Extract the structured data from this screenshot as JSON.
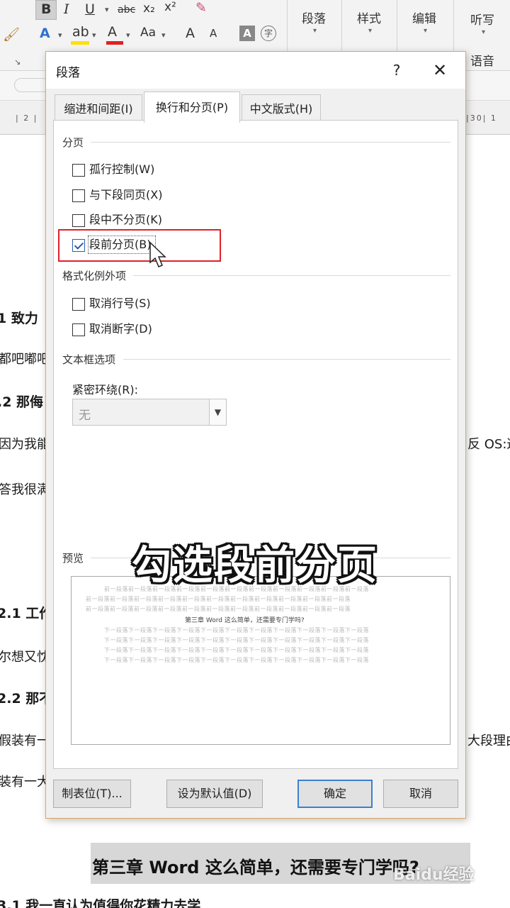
{
  "ribbon": {
    "format_glyphs": [
      "B",
      "I",
      "U",
      "abc",
      "x₂",
      "x²",
      "A",
      "A",
      "Aa",
      "A",
      "A"
    ],
    "groups": [
      "段落",
      "样式",
      "编辑",
      "听写",
      "语音"
    ]
  },
  "ruler": {
    "left_mark": "| 2 |",
    "right_mark": "|30|  1"
  },
  "document": {
    "fragments": [
      "1 致力",
      "都吧嘟吧",
      ".2 那侮",
      "因为我能",
      "答我很满",
      "2.1 工作",
      "尔想又忱",
      "2.2 那不",
      "假装有一",
      "装有一大",
      "反 OS:这",
      "大段理由"
    ],
    "chapter_title": "第三章 Word 这么简单，还需要专门学吗?",
    "bottom_fragment": "3.1 我一直认为值得你花精力去学",
    "watermark": "Baidu经验"
  },
  "dialog": {
    "title": "段落",
    "help": "?",
    "close": "✕",
    "tabs": [
      {
        "label": "缩进和间距(I)"
      },
      {
        "label": "换行和分页(P)"
      },
      {
        "label": "中文版式(H)"
      }
    ],
    "sections": {
      "pagination": "分页",
      "format_exceptions": "格式化例外项",
      "textbox_options": "文本框选项",
      "preview": "预览"
    },
    "checkboxes": [
      {
        "label": "孤行控制(W)",
        "checked": false
      },
      {
        "label": "与下段同页(X)",
        "checked": false
      },
      {
        "label": "段中不分页(K)",
        "checked": false
      },
      {
        "label": "段前分页(B)",
        "checked": true
      },
      {
        "label": "取消行号(S)",
        "checked": false
      },
      {
        "label": "取消断字(D)",
        "checked": false
      }
    ],
    "tight_wrap": {
      "label": "紧密环绕(R):",
      "value": "无"
    },
    "preview": {
      "before_line": "前一段落前一段落前一段落前一段落前一段落前一段落前一段落前一段落前一段落前一段落前一段落",
      "sample_title": "第三章 Word 这么简单，还需要专门学吗?",
      "after_line": "下一段落下一段落下一段落下一段落下一段落下一段落下一段落下一段落下一段落下一段落下一段落"
    },
    "buttons": {
      "tabs": "制表位(T)...",
      "set_default": "设为默认值(D)",
      "ok": "确定",
      "cancel": "取消"
    }
  },
  "caption": "勾选段前分页"
}
